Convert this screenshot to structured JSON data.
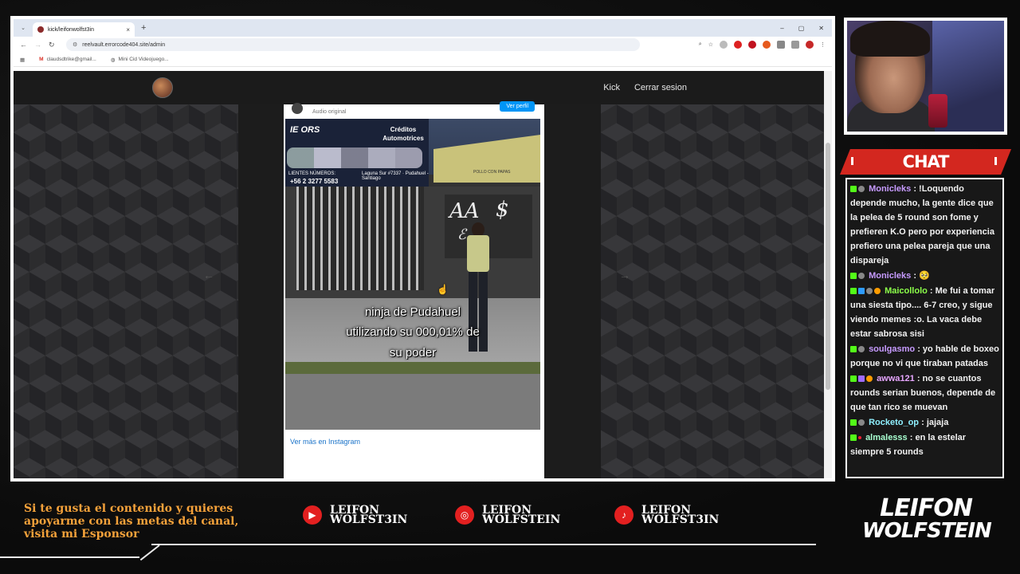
{
  "browser": {
    "tab_title": "kick/leifonwolfst3in",
    "url": "reelvault.errorcode404.site/admin",
    "bookmarks": [
      {
        "label": "claudsdtrike@gmail..."
      },
      {
        "label": "Mini Cid Videojuego..."
      }
    ],
    "window_controls": [
      "–",
      "▢",
      "✕"
    ]
  },
  "site": {
    "nav_links": [
      "Kick",
      "Cerrar sesion"
    ],
    "arrow_left": "←",
    "arrow_right": "→"
  },
  "instagram": {
    "audio_label": "Audio original",
    "profile_button": "Ver perfil",
    "video_sign_left": "IE ORS",
    "video_sign_right": "Créditos Automotrices",
    "video_sign_phone_label": "LIENTES NÚMEROS:",
    "video_sign_phone": "+56 2 3277 5583",
    "video_sign_address": "Laguna Sur #7337 · Pudahuel - Santiago",
    "video_shop": "POLLO CON PAPAS",
    "caption_lines": [
      "ninja de Pudahuel",
      "utilizando su 000,01% de",
      "su poder"
    ],
    "footer_link": "Ver más en Instagram"
  },
  "chat": {
    "title": "CHAT",
    "messages": [
      {
        "user": "Monicleks",
        "color": "#c79bff",
        "text": ": !Loquendo depende mucho, la gente dice que la pelea de 5 round son fome y prefieren K.O pero por experiencia prefiero una pelea pareja que una dispareja"
      },
      {
        "user": "Monicleks",
        "color": "#c79bff",
        "text": ": 🥺"
      },
      {
        "user": "Maicollolo",
        "color": "#8cff4a",
        "text": ": Me fui a tomar una siesta tipo.... 6-7 creo, y sigue viendo memes :o. La vaca debe estar sabrosa sisi"
      },
      {
        "user": "soulgasmo",
        "color": "#c79bff",
        "text": ": yo hable de boxeo porque no vi que tiraban patadas"
      },
      {
        "user": "awwa121",
        "color": "#e7a6ff",
        "text": ": no se cuantos rounds serian buenos, depende de que tan rico se muevan"
      },
      {
        "user": "Rocketo_op",
        "color": "#8ff0ff",
        "text": ": jajaja"
      },
      {
        "user": "almalesss",
        "color": "#a8ffd0",
        "text": ": en la estelar siempre 5 rounds"
      }
    ]
  },
  "footer": {
    "sponsor_text": "Si te gusta el contenido y quieres apoyarme con las metas del canal, visita mi Esponsor",
    "socials": [
      {
        "icon": "youtube-icon",
        "line1": "LEIFON",
        "line2": "WOLFST3IN"
      },
      {
        "icon": "instagram-icon",
        "line1": "LEIFON",
        "line2": "WOLFSTEIN"
      },
      {
        "icon": "tiktok-icon",
        "line1": "LEIFON",
        "line2": "WOLFST3IN"
      }
    ],
    "brand_line1": "LEIFON",
    "brand_line2": "WOLFSTEIN"
  },
  "colors": {
    "accent_red": "#d3271f",
    "sponsor_orange": "#f4a13a",
    "kick_green": "#53fc18"
  }
}
